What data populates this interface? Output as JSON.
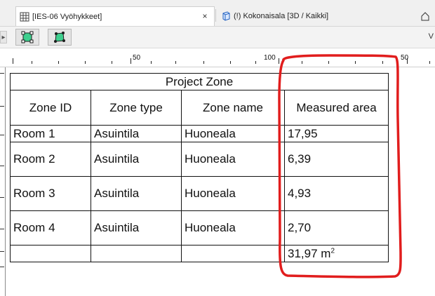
{
  "tabs": [
    {
      "label": "[IES-06 Vyöhykkeet]",
      "icon": "schedule-table-icon",
      "close": "×",
      "active": true
    },
    {
      "label": "(!) Kokonaisala [3D / Kaikki]",
      "icon": "3d-view-icon",
      "active": false
    },
    {
      "label": "",
      "icon": "home-view-icon",
      "active": false
    }
  ],
  "toolbar": {
    "right_text": "V",
    "buttons": [
      "zone-select-icon",
      "zone-edit-icon"
    ]
  },
  "ruler": {
    "labels": [
      "50",
      "100",
      "50"
    ]
  },
  "schedule": {
    "title": "Project Zone",
    "headers": [
      "Zone ID",
      "Zone type",
      "Zone name",
      "Measured area"
    ],
    "rows": [
      {
        "id": "Room 1",
        "type": "Asuintila",
        "name": "Huoneala",
        "area": "17,95"
      },
      {
        "id": "Room 2",
        "type": "Asuintila",
        "name": "Huoneala",
        "area": "6,39"
      },
      {
        "id": "Room 3",
        "type": "Asuintila",
        "name": "Huoneala",
        "area": "4,93"
      },
      {
        "id": "Room 4",
        "type": "Asuintila",
        "name": "Huoneala",
        "area": "2,70"
      }
    ],
    "total": {
      "value": "31,97 m",
      "unit_sup": "2"
    }
  },
  "colors": {
    "annotation": "#e11d1d",
    "zone_icon": "#3ecf8e"
  }
}
